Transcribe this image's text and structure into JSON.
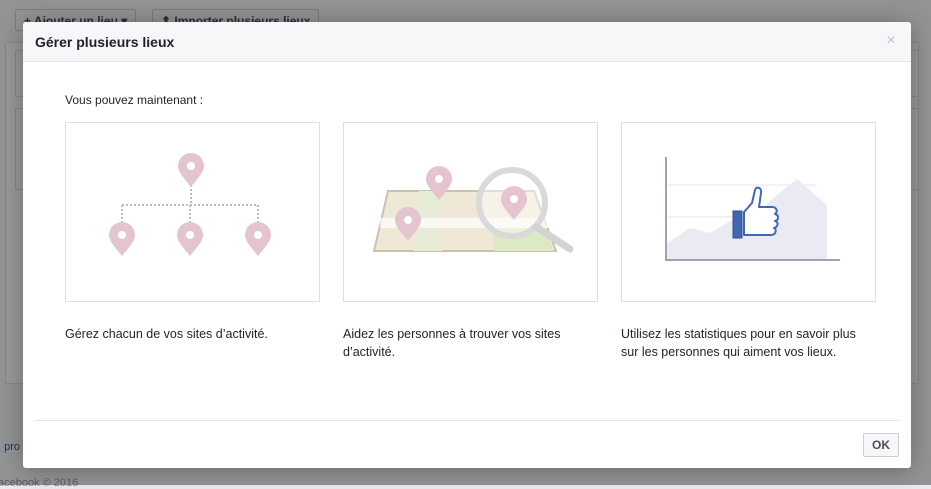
{
  "background": {
    "add_place_label": "+ Ajouter un lieu ▾",
    "import_label": "⬆ Importer plusieurs lieux",
    "footer_link": ". pro",
    "footer_copyright": "acebook © 2016"
  },
  "dialog": {
    "title": "Gérer plusieurs lieux",
    "close_glyph": "×",
    "intro": "Vous pouvez maintenant :",
    "cards": [
      {
        "icon": "location-tree-icon",
        "caption": "Gérez chacun de vos sites d’activité."
      },
      {
        "icon": "map-search-icon",
        "caption": "Aidez les personnes à trouver vos sites d’activité."
      },
      {
        "icon": "stats-like-icon",
        "caption": "Utilisez les statistiques pour en savoir plus sur les personnes qui aiment vos lieux."
      }
    ],
    "ok_label": "OK"
  },
  "colors": {
    "pin": "#e4c5cf",
    "chart_fill": "#eaeaf3",
    "thumb": "#4267b2"
  }
}
